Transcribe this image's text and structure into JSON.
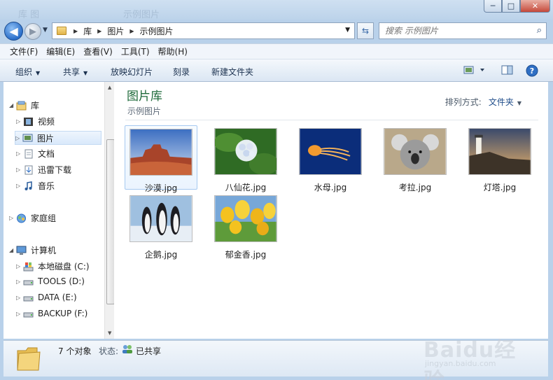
{
  "window": {
    "titlebar_ghost_left": "库 图",
    "titlebar_ghost_right": "示例图片",
    "controls": [
      "─",
      "□",
      "✕"
    ]
  },
  "nav": {
    "back": "◀",
    "forward": "▶",
    "breadcrumbs": [
      "库",
      "图片",
      "示例图片"
    ],
    "search_placeholder": "搜索 示例图片"
  },
  "menu": [
    "文件(F)",
    "编辑(E)",
    "查看(V)",
    "工具(T)",
    "帮助(H)"
  ],
  "commands": {
    "organize": "组织",
    "share": "共享",
    "slideshow": "放映幻灯片",
    "burn": "刻录",
    "new_folder": "新建文件夹"
  },
  "tree": {
    "libraries": "库",
    "videos": "视频",
    "pictures": "图片",
    "documents": "文档",
    "thunder": "迅雷下载",
    "music": "音乐",
    "homegroup": "家庭组",
    "computer": "计算机",
    "drives": [
      "本地磁盘 (C:)",
      "TOOLS (D:)",
      "DATA (E:)",
      "BACKUP (F:)"
    ]
  },
  "content": {
    "title": "图片库",
    "subtitle": "示例图片",
    "sort_label": "排列方式:",
    "sort_value": "文件夹",
    "files": [
      "沙漠.jpg",
      "八仙花.jpg",
      "水母.jpg",
      "考拉.jpg",
      "灯塔.jpg",
      "企鹅.jpg",
      "郁金香.jpg"
    ]
  },
  "status": {
    "count": "7 个对象",
    "state_label": "状态:",
    "state_value": "已共享"
  },
  "watermark": {
    "brand": "Baidu经验",
    "url": "jingyan.baidu.com"
  }
}
